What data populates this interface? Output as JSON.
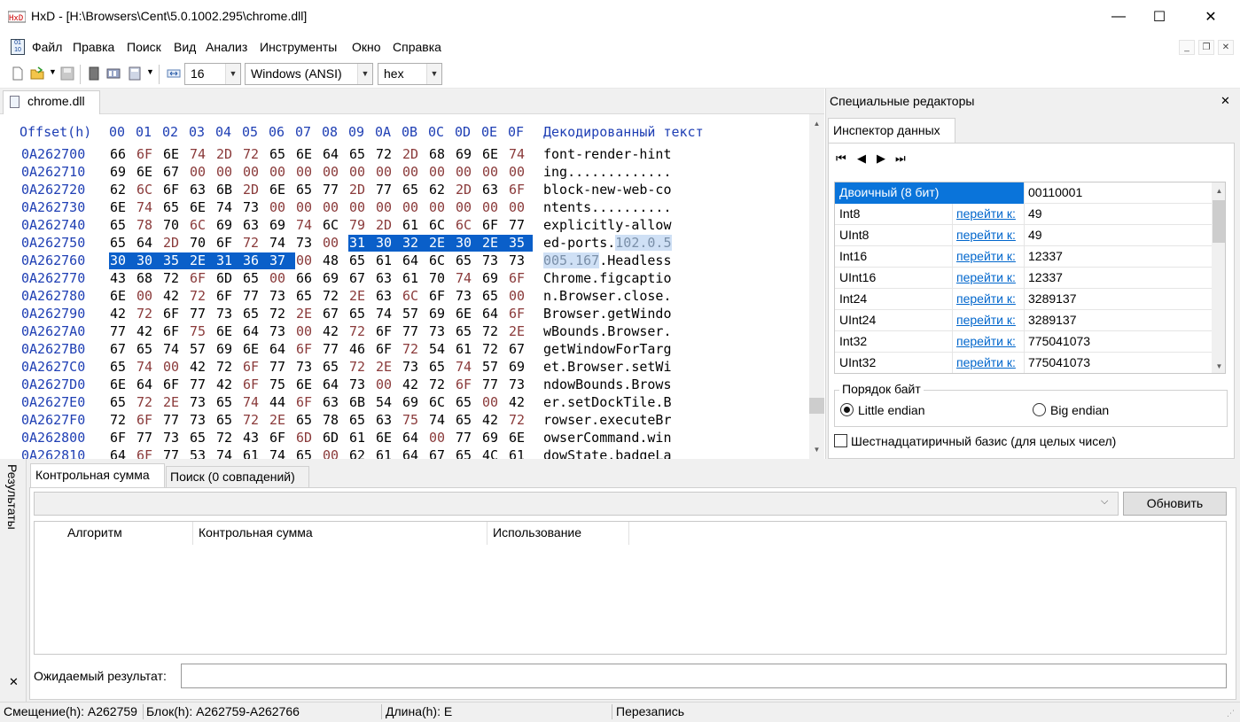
{
  "window": {
    "title": "HxD - [H:\\Browsers\\Cent\\5.0.1002.295\\chrome.dll]",
    "minimize": "—",
    "maximize": "☐",
    "close": "✕"
  },
  "menu": [
    "Файл",
    "Правка",
    "Поиск",
    "Вид",
    "Анализ",
    "Инструменты",
    "Окно",
    "Справка"
  ],
  "mdi_buttons": [
    "_",
    "❐",
    "✕"
  ],
  "toolbar": {
    "bytes_per_row": "16",
    "charset": "Windows (ANSI)",
    "offset_base": "hex"
  },
  "document_tab": "chrome.dll",
  "hex_view": {
    "offset_header": "Offset(h)",
    "column_headers": [
      "00",
      "01",
      "02",
      "03",
      "04",
      "05",
      "06",
      "07",
      "08",
      "09",
      "0A",
      "0B",
      "0C",
      "0D",
      "0E",
      "0F"
    ],
    "text_header": "Декодированный текст",
    "rows": [
      {
        "offset": "0A262700",
        "bytes": [
          "66",
          "6F",
          "6E",
          "74",
          "2D",
          "72",
          "65",
          "6E",
          "64",
          "65",
          "72",
          "2D",
          "68",
          "69",
          "6E",
          "74"
        ],
        "text": "font-render-hint"
      },
      {
        "offset": "0A262710",
        "bytes": [
          "69",
          "6E",
          "67",
          "00",
          "00",
          "00",
          "00",
          "00",
          "00",
          "00",
          "00",
          "00",
          "00",
          "00",
          "00",
          "00"
        ],
        "text": "ing............."
      },
      {
        "offset": "0A262720",
        "bytes": [
          "62",
          "6C",
          "6F",
          "63",
          "6B",
          "2D",
          "6E",
          "65",
          "77",
          "2D",
          "77",
          "65",
          "62",
          "2D",
          "63",
          "6F"
        ],
        "text": "block-new-web-co"
      },
      {
        "offset": "0A262730",
        "bytes": [
          "6E",
          "74",
          "65",
          "6E",
          "74",
          "73",
          "00",
          "00",
          "00",
          "00",
          "00",
          "00",
          "00",
          "00",
          "00",
          "00"
        ],
        "text": "ntents.........."
      },
      {
        "offset": "0A262740",
        "bytes": [
          "65",
          "78",
          "70",
          "6C",
          "69",
          "63",
          "69",
          "74",
          "6C",
          "79",
          "2D",
          "61",
          "6C",
          "6C",
          "6F",
          "77"
        ],
        "text": "explicitly-allow"
      },
      {
        "offset": "0A262750",
        "bytes": [
          "65",
          "64",
          "2D",
          "70",
          "6F",
          "72",
          "74",
          "73",
          "00",
          "31",
          "30",
          "32",
          "2E",
          "30",
          "2E",
          "35"
        ],
        "text": "ed-ports.",
        "text_sel": "102.0.5"
      },
      {
        "offset": "0A262760",
        "bytes": [
          "30",
          "30",
          "35",
          "2E",
          "31",
          "36",
          "37",
          "00",
          "48",
          "65",
          "61",
          "64",
          "6C",
          "65",
          "73",
          "73"
        ],
        "text_sel": "005.167",
        "text": ".Headless"
      },
      {
        "offset": "0A262770",
        "bytes": [
          "43",
          "68",
          "72",
          "6F",
          "6D",
          "65",
          "00",
          "66",
          "69",
          "67",
          "63",
          "61",
          "70",
          "74",
          "69",
          "6F"
        ],
        "text": "Chrome.figcaptio"
      },
      {
        "offset": "0A262780",
        "bytes": [
          "6E",
          "00",
          "42",
          "72",
          "6F",
          "77",
          "73",
          "65",
          "72",
          "2E",
          "63",
          "6C",
          "6F",
          "73",
          "65",
          "00"
        ],
        "text": "n.Browser.close."
      },
      {
        "offset": "0A262790",
        "bytes": [
          "42",
          "72",
          "6F",
          "77",
          "73",
          "65",
          "72",
          "2E",
          "67",
          "65",
          "74",
          "57",
          "69",
          "6E",
          "64",
          "6F"
        ],
        "text": "Browser.getWindo"
      },
      {
        "offset": "0A2627A0",
        "bytes": [
          "77",
          "42",
          "6F",
          "75",
          "6E",
          "64",
          "73",
          "00",
          "42",
          "72",
          "6F",
          "77",
          "73",
          "65",
          "72",
          "2E"
        ],
        "text": "wBounds.Browser."
      },
      {
        "offset": "0A2627B0",
        "bytes": [
          "67",
          "65",
          "74",
          "57",
          "69",
          "6E",
          "64",
          "6F",
          "77",
          "46",
          "6F",
          "72",
          "54",
          "61",
          "72",
          "67"
        ],
        "text": "getWindowForTarg"
      },
      {
        "offset": "0A2627C0",
        "bytes": [
          "65",
          "74",
          "00",
          "42",
          "72",
          "6F",
          "77",
          "73",
          "65",
          "72",
          "2E",
          "73",
          "65",
          "74",
          "57",
          "69"
        ],
        "text": "et.Browser.setWi"
      },
      {
        "offset": "0A2627D0",
        "bytes": [
          "6E",
          "64",
          "6F",
          "77",
          "42",
          "6F",
          "75",
          "6E",
          "64",
          "73",
          "00",
          "42",
          "72",
          "6F",
          "77",
          "73"
        ],
        "text": "ndowBounds.Brows"
      },
      {
        "offset": "0A2627E0",
        "bytes": [
          "65",
          "72",
          "2E",
          "73",
          "65",
          "74",
          "44",
          "6F",
          "63",
          "6B",
          "54",
          "69",
          "6C",
          "65",
          "00",
          "42"
        ],
        "text": "er.setDockTile.B"
      },
      {
        "offset": "0A2627F0",
        "bytes": [
          "72",
          "6F",
          "77",
          "73",
          "65",
          "72",
          "2E",
          "65",
          "78",
          "65",
          "63",
          "75",
          "74",
          "65",
          "42",
          "72"
        ],
        "text": "rowser.executeBr"
      },
      {
        "offset": "0A262800",
        "bytes": [
          "6F",
          "77",
          "73",
          "65",
          "72",
          "43",
          "6F",
          "6D",
          "6D",
          "61",
          "6E",
          "64",
          "00",
          "77",
          "69",
          "6E"
        ],
        "text": "owserCommand.win"
      },
      {
        "offset": "0A262810",
        "bytes": [
          "64",
          "6F",
          "77",
          "53",
          "74",
          "61",
          "74",
          "65",
          "00",
          "62",
          "61",
          "64",
          "67",
          "65",
          "4C",
          "61"
        ],
        "text": "dowState.badgeLa"
      }
    ]
  },
  "special_editors": {
    "title": "Специальные редакторы",
    "close": "✕",
    "tab": "Инспектор данных",
    "nav": [
      "⏮",
      "◀",
      "▶",
      "⏭"
    ],
    "grid": [
      {
        "name": "Двоичный (8 бит)",
        "link": "",
        "value": "00110001"
      },
      {
        "name": "Int8",
        "link": "перейти к:",
        "value": "49"
      },
      {
        "name": "UInt8",
        "link": "перейти к:",
        "value": "49"
      },
      {
        "name": "Int16",
        "link": "перейти к:",
        "value": "12337"
      },
      {
        "name": "UInt16",
        "link": "перейти к:",
        "value": "12337"
      },
      {
        "name": "Int24",
        "link": "перейти к:",
        "value": "3289137"
      },
      {
        "name": "UInt24",
        "link": "перейти к:",
        "value": "3289137"
      },
      {
        "name": "Int32",
        "link": "перейти к:",
        "value": "775041073"
      },
      {
        "name": "UInt32",
        "link": "перейти к:",
        "value": "775041073"
      }
    ],
    "byte_order_label": "Порядок байт",
    "little_endian": "Little endian",
    "big_endian": "Big endian",
    "hex_basis": "Шестнадцатиричный базис (для целых чисел)"
  },
  "results": {
    "side_label": "Результаты",
    "close": "✕",
    "tabs": [
      "Контрольная сумма",
      "Поиск (0 совпадений)"
    ],
    "refresh": "Обновить",
    "columns": [
      "Алгоритм",
      "Контрольная сумма",
      "Использование"
    ],
    "expected_label": "Ожидаемый результат:"
  },
  "status": {
    "offset": "Смещение(h): A262759",
    "block": "Блок(h): A262759-A262766",
    "length": "Длина(h): E",
    "mode": "Перезапись"
  },
  "colors": {
    "offset_blue": "#1f3fb4",
    "selection": "#0a5fc9",
    "link": "#0066cc"
  }
}
